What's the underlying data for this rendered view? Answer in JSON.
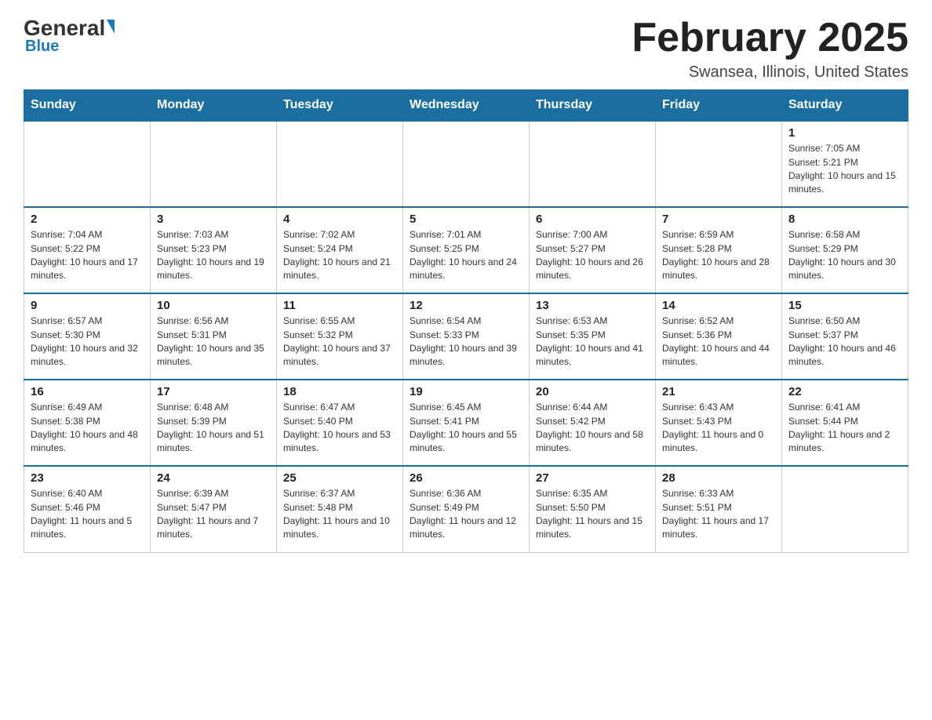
{
  "header": {
    "logo": {
      "general": "General",
      "blue": "Blue",
      "underline": "Blue"
    },
    "title": "February 2025",
    "location": "Swansea, Illinois, United States"
  },
  "days_of_week": [
    "Sunday",
    "Monday",
    "Tuesday",
    "Wednesday",
    "Thursday",
    "Friday",
    "Saturday"
  ],
  "weeks": [
    [
      {
        "day": "",
        "sunrise": "",
        "sunset": "",
        "daylight": ""
      },
      {
        "day": "",
        "sunrise": "",
        "sunset": "",
        "daylight": ""
      },
      {
        "day": "",
        "sunrise": "",
        "sunset": "",
        "daylight": ""
      },
      {
        "day": "",
        "sunrise": "",
        "sunset": "",
        "daylight": ""
      },
      {
        "day": "",
        "sunrise": "",
        "sunset": "",
        "daylight": ""
      },
      {
        "day": "",
        "sunrise": "",
        "sunset": "",
        "daylight": ""
      },
      {
        "day": "1",
        "sunrise": "Sunrise: 7:05 AM",
        "sunset": "Sunset: 5:21 PM",
        "daylight": "Daylight: 10 hours and 15 minutes."
      }
    ],
    [
      {
        "day": "2",
        "sunrise": "Sunrise: 7:04 AM",
        "sunset": "Sunset: 5:22 PM",
        "daylight": "Daylight: 10 hours and 17 minutes."
      },
      {
        "day": "3",
        "sunrise": "Sunrise: 7:03 AM",
        "sunset": "Sunset: 5:23 PM",
        "daylight": "Daylight: 10 hours and 19 minutes."
      },
      {
        "day": "4",
        "sunrise": "Sunrise: 7:02 AM",
        "sunset": "Sunset: 5:24 PM",
        "daylight": "Daylight: 10 hours and 21 minutes."
      },
      {
        "day": "5",
        "sunrise": "Sunrise: 7:01 AM",
        "sunset": "Sunset: 5:25 PM",
        "daylight": "Daylight: 10 hours and 24 minutes."
      },
      {
        "day": "6",
        "sunrise": "Sunrise: 7:00 AM",
        "sunset": "Sunset: 5:27 PM",
        "daylight": "Daylight: 10 hours and 26 minutes."
      },
      {
        "day": "7",
        "sunrise": "Sunrise: 6:59 AM",
        "sunset": "Sunset: 5:28 PM",
        "daylight": "Daylight: 10 hours and 28 minutes."
      },
      {
        "day": "8",
        "sunrise": "Sunrise: 6:58 AM",
        "sunset": "Sunset: 5:29 PM",
        "daylight": "Daylight: 10 hours and 30 minutes."
      }
    ],
    [
      {
        "day": "9",
        "sunrise": "Sunrise: 6:57 AM",
        "sunset": "Sunset: 5:30 PM",
        "daylight": "Daylight: 10 hours and 32 minutes."
      },
      {
        "day": "10",
        "sunrise": "Sunrise: 6:56 AM",
        "sunset": "Sunset: 5:31 PM",
        "daylight": "Daylight: 10 hours and 35 minutes."
      },
      {
        "day": "11",
        "sunrise": "Sunrise: 6:55 AM",
        "sunset": "Sunset: 5:32 PM",
        "daylight": "Daylight: 10 hours and 37 minutes."
      },
      {
        "day": "12",
        "sunrise": "Sunrise: 6:54 AM",
        "sunset": "Sunset: 5:33 PM",
        "daylight": "Daylight: 10 hours and 39 minutes."
      },
      {
        "day": "13",
        "sunrise": "Sunrise: 6:53 AM",
        "sunset": "Sunset: 5:35 PM",
        "daylight": "Daylight: 10 hours and 41 minutes."
      },
      {
        "day": "14",
        "sunrise": "Sunrise: 6:52 AM",
        "sunset": "Sunset: 5:36 PM",
        "daylight": "Daylight: 10 hours and 44 minutes."
      },
      {
        "day": "15",
        "sunrise": "Sunrise: 6:50 AM",
        "sunset": "Sunset: 5:37 PM",
        "daylight": "Daylight: 10 hours and 46 minutes."
      }
    ],
    [
      {
        "day": "16",
        "sunrise": "Sunrise: 6:49 AM",
        "sunset": "Sunset: 5:38 PM",
        "daylight": "Daylight: 10 hours and 48 minutes."
      },
      {
        "day": "17",
        "sunrise": "Sunrise: 6:48 AM",
        "sunset": "Sunset: 5:39 PM",
        "daylight": "Daylight: 10 hours and 51 minutes."
      },
      {
        "day": "18",
        "sunrise": "Sunrise: 6:47 AM",
        "sunset": "Sunset: 5:40 PM",
        "daylight": "Daylight: 10 hours and 53 minutes."
      },
      {
        "day": "19",
        "sunrise": "Sunrise: 6:45 AM",
        "sunset": "Sunset: 5:41 PM",
        "daylight": "Daylight: 10 hours and 55 minutes."
      },
      {
        "day": "20",
        "sunrise": "Sunrise: 6:44 AM",
        "sunset": "Sunset: 5:42 PM",
        "daylight": "Daylight: 10 hours and 58 minutes."
      },
      {
        "day": "21",
        "sunrise": "Sunrise: 6:43 AM",
        "sunset": "Sunset: 5:43 PM",
        "daylight": "Daylight: 11 hours and 0 minutes."
      },
      {
        "day": "22",
        "sunrise": "Sunrise: 6:41 AM",
        "sunset": "Sunset: 5:44 PM",
        "daylight": "Daylight: 11 hours and 2 minutes."
      }
    ],
    [
      {
        "day": "23",
        "sunrise": "Sunrise: 6:40 AM",
        "sunset": "Sunset: 5:46 PM",
        "daylight": "Daylight: 11 hours and 5 minutes."
      },
      {
        "day": "24",
        "sunrise": "Sunrise: 6:39 AM",
        "sunset": "Sunset: 5:47 PM",
        "daylight": "Daylight: 11 hours and 7 minutes."
      },
      {
        "day": "25",
        "sunrise": "Sunrise: 6:37 AM",
        "sunset": "Sunset: 5:48 PM",
        "daylight": "Daylight: 11 hours and 10 minutes."
      },
      {
        "day": "26",
        "sunrise": "Sunrise: 6:36 AM",
        "sunset": "Sunset: 5:49 PM",
        "daylight": "Daylight: 11 hours and 12 minutes."
      },
      {
        "day": "27",
        "sunrise": "Sunrise: 6:35 AM",
        "sunset": "Sunset: 5:50 PM",
        "daylight": "Daylight: 11 hours and 15 minutes."
      },
      {
        "day": "28",
        "sunrise": "Sunrise: 6:33 AM",
        "sunset": "Sunset: 5:51 PM",
        "daylight": "Daylight: 11 hours and 17 minutes."
      },
      {
        "day": "",
        "sunrise": "",
        "sunset": "",
        "daylight": ""
      }
    ]
  ]
}
